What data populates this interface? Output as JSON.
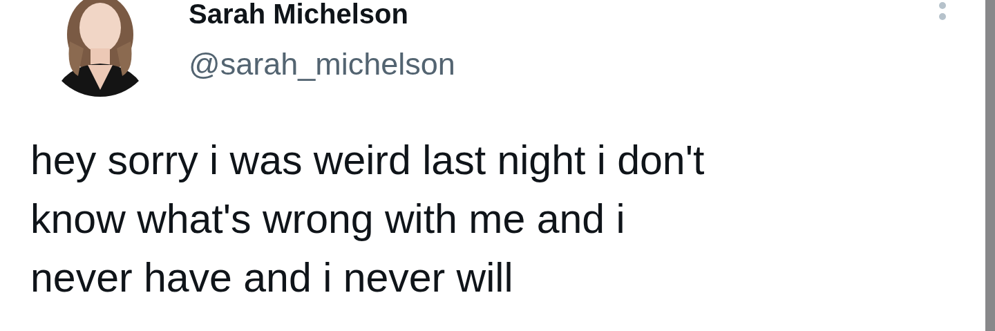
{
  "tweet": {
    "author_name": "Sarah Michelson",
    "handle": "@sarah_michelson",
    "text": "hey sorry i was weird last night i don't\nknow what's wrong with me and i\nnever have and i never will"
  }
}
